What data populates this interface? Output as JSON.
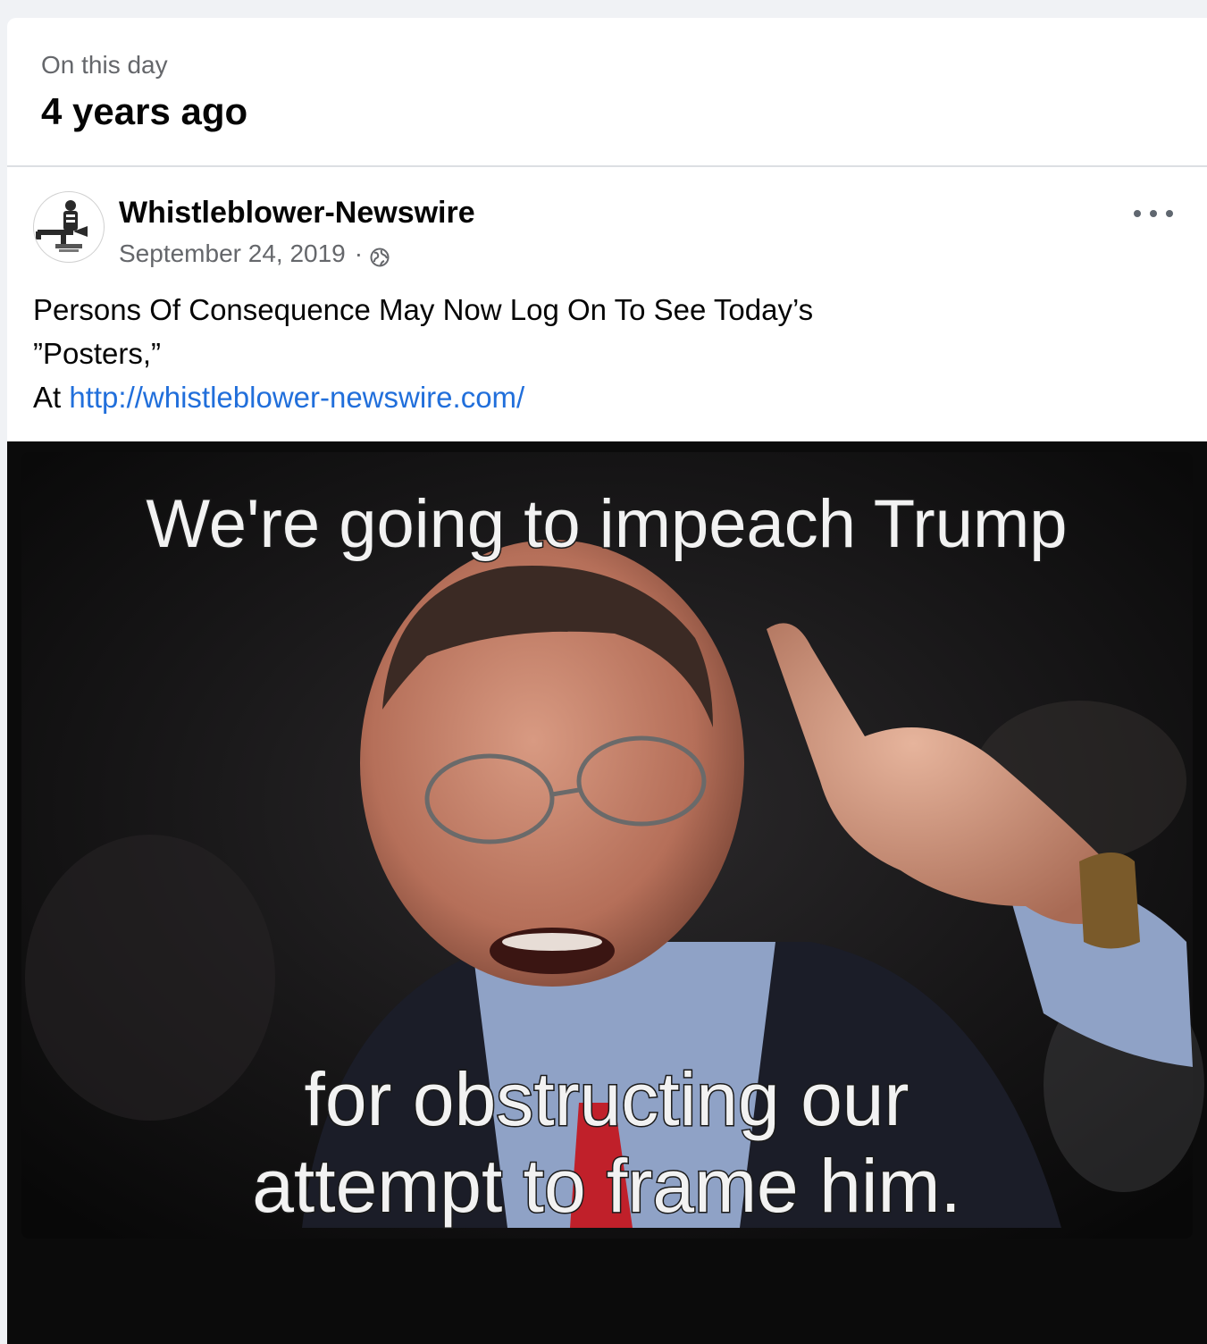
{
  "memory": {
    "kicker": "On this day",
    "title": "4 years ago"
  },
  "post": {
    "page_name": "Whistleblower-Newswire",
    "date": "September 24, 2019",
    "separator": "·",
    "privacy_icon": "globe-icon",
    "more_icon": "more-options-icon",
    "text_line1": "Persons Of Consequence May Now Log On To See Today’s",
    "text_line2": "”Posters,”",
    "text_line3_prefix": "At ",
    "link": "http://whistleblower-newswire.com/"
  },
  "image": {
    "caption_top": "We're going to impeach Trump",
    "caption_bottom_line1": "for obstructing our",
    "caption_bottom_line2": "attempt to frame him."
  },
  "colors": {
    "page_background": "#f0f2f5",
    "card_background": "#ffffff",
    "primary_text": "#050505",
    "secondary_text": "#65676b",
    "link": "#216fdb"
  }
}
